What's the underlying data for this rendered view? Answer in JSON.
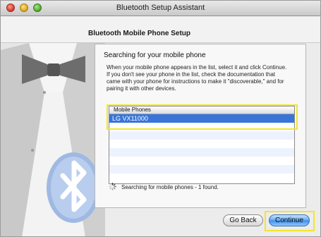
{
  "window": {
    "title": "Bluetooth Setup Assistant"
  },
  "header": {
    "step_title": "Bluetooth Mobile Phone Setup"
  },
  "panel": {
    "title": "Searching for your mobile phone",
    "lines": [
      "When your mobile phone appears in the list, select it and click Continue.",
      "If you don't see your phone in the list, check the documentation that",
      "came with your phone for instructions to make it \"discoverable,\" and for",
      "pairing it with other devices."
    ]
  },
  "list": {
    "header": "Mobile Phones",
    "items": [
      "LG VX11000"
    ]
  },
  "status": {
    "text": "Searching for mobile phones - 1 found."
  },
  "buttons": {
    "back": "Go Back",
    "continue": "Continue"
  },
  "colors": {
    "selection": "#3875d7",
    "highlight": "#f2e629",
    "default_button": "#5fa8ef"
  }
}
